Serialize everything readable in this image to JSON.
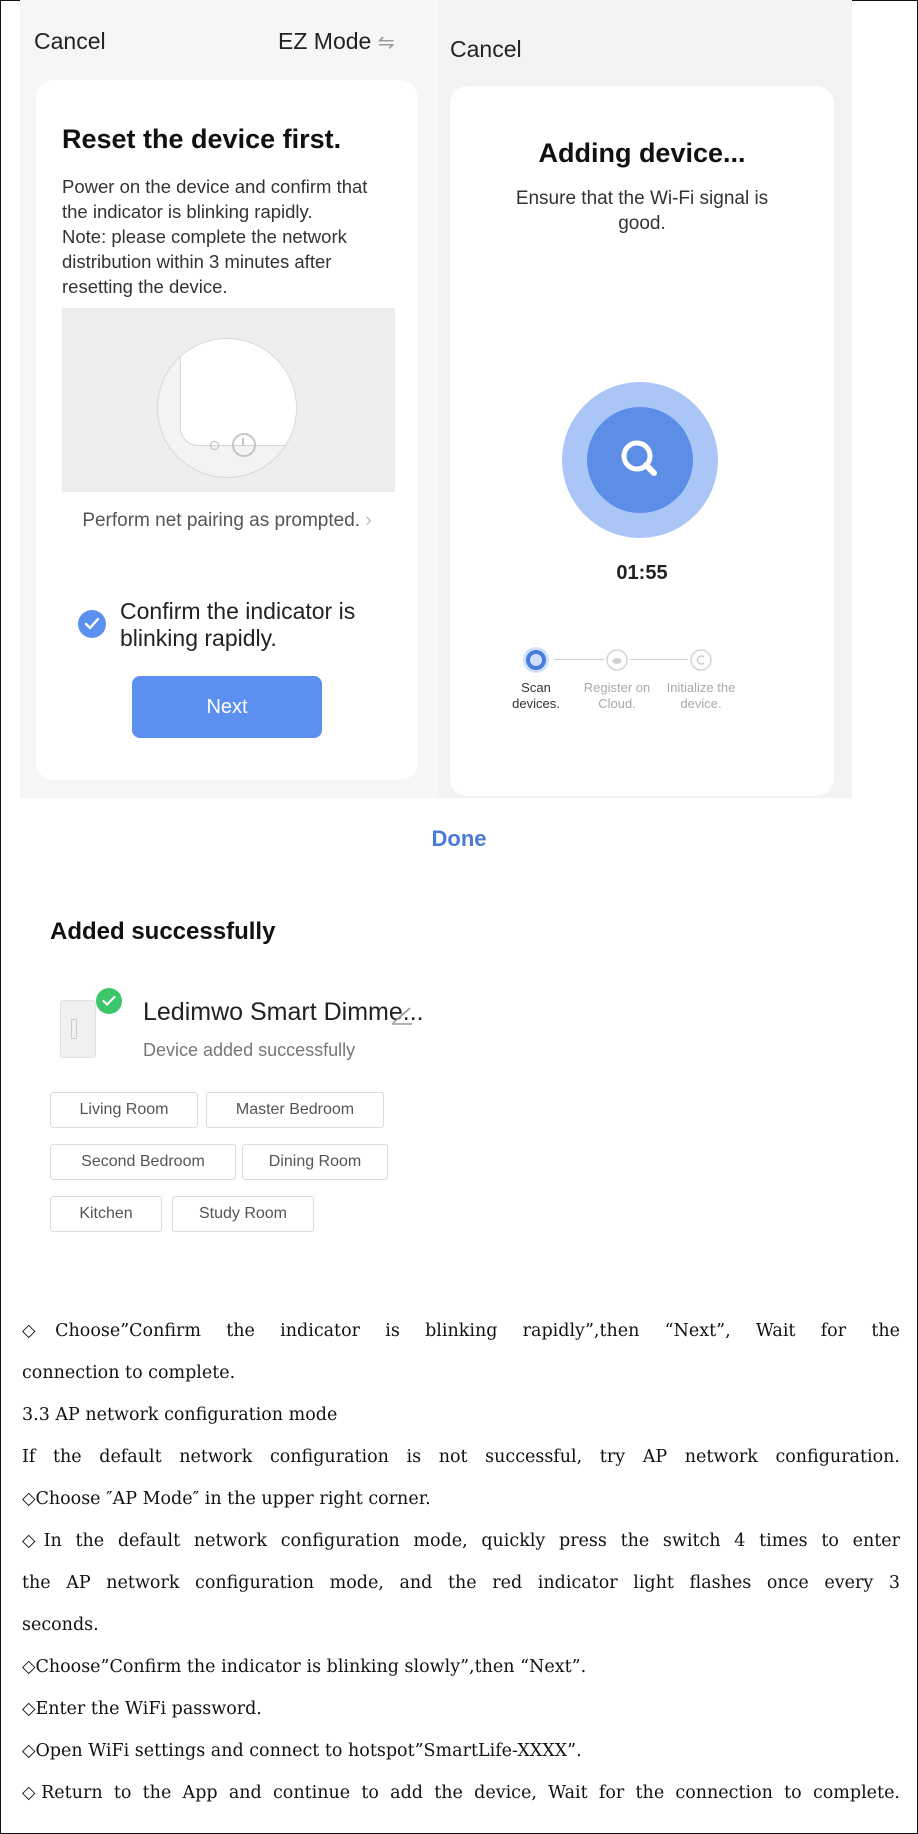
{
  "screen1": {
    "cancel": "Cancel",
    "mode": "EZ Mode",
    "title": "Reset the device first.",
    "desc": [
      "Power on the device and confirm that",
      "the indicator is blinking rapidly.",
      "Note: please complete the network",
      "distribution within 3 minutes after",
      "resetting the device."
    ],
    "prompt": "Perform net pairing as prompted.",
    "confirm": [
      "Confirm the indicator is",
      "blinking rapidly."
    ],
    "next": "Next"
  },
  "screen2": {
    "cancel": "Cancel",
    "title": "Adding device...",
    "desc": [
      "Ensure that the Wi-Fi signal is",
      "good."
    ],
    "timer": "01:55",
    "steps": [
      {
        "line1": "Scan",
        "line2": "devices."
      },
      {
        "line1": "Register on",
        "line2": "Cloud."
      },
      {
        "line1": "Initialize the",
        "line2": "device."
      }
    ]
  },
  "screen3": {
    "done": "Done",
    "title": "Added successfully",
    "device_name": "Ledimwo Smart Dimme...",
    "device_status": "Device added successfully",
    "rooms": [
      "Living Room",
      "Master Bedroom",
      "Second Bedroom",
      "Dining Room",
      "Kitchen",
      "Study Room"
    ]
  },
  "text": [
    "◇Choose”Confirm the indicator is blinking rapidly”,then “Next”, Wait for the",
    "connection to complete.",
    "3.3 AP network configuration mode",
    "If the default network configuration is not successful, try AP network configuration.",
    "◇Choose ″AP Mode″ in the upper right corner.",
    "◇In the default network configuration mode, quickly press the switch 4 times to enter",
    "the AP network configuration mode, and the red indicator light flashes once every 3",
    "seconds.",
    "◇Choose”Confirm the indicator is blinking slowly”,then “Next”.",
    "◇Enter the WiFi password.",
    "◇Open WiFi settings and connect to hotspot”SmartLife-XXXX”.",
    "◇Return to the App and continue to add the device, Wait for the connection to complete."
  ],
  "colors": {
    "accent": "#5b8ff0",
    "link": "#4a7bd8",
    "success": "#3cc76a"
  }
}
